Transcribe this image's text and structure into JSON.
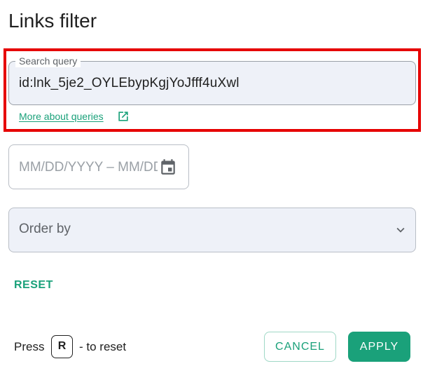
{
  "dialog": {
    "title": "Links filter"
  },
  "search": {
    "label": "Search query",
    "value": "id:lnk_5je2_OYLEbypKgjYoJfff4uXwl",
    "help_link": "More about queries",
    "help_icon": "external-link-icon"
  },
  "date_range": {
    "placeholder": "MM/DD/YYYY – MM/DD/YYYY",
    "icon": "calendar-icon"
  },
  "order_by": {
    "label": "Order by",
    "icon": "chevron-down-icon"
  },
  "actions": {
    "reset_label": "RESET",
    "hint_press": "Press",
    "hint_key": "R",
    "hint_suffix": "- to reset",
    "cancel_label": "CANCEL",
    "apply_label": "APPLY"
  },
  "colors": {
    "accent": "#1aa17a",
    "highlight": "#e60000",
    "field_bg": "#eef1f8"
  }
}
